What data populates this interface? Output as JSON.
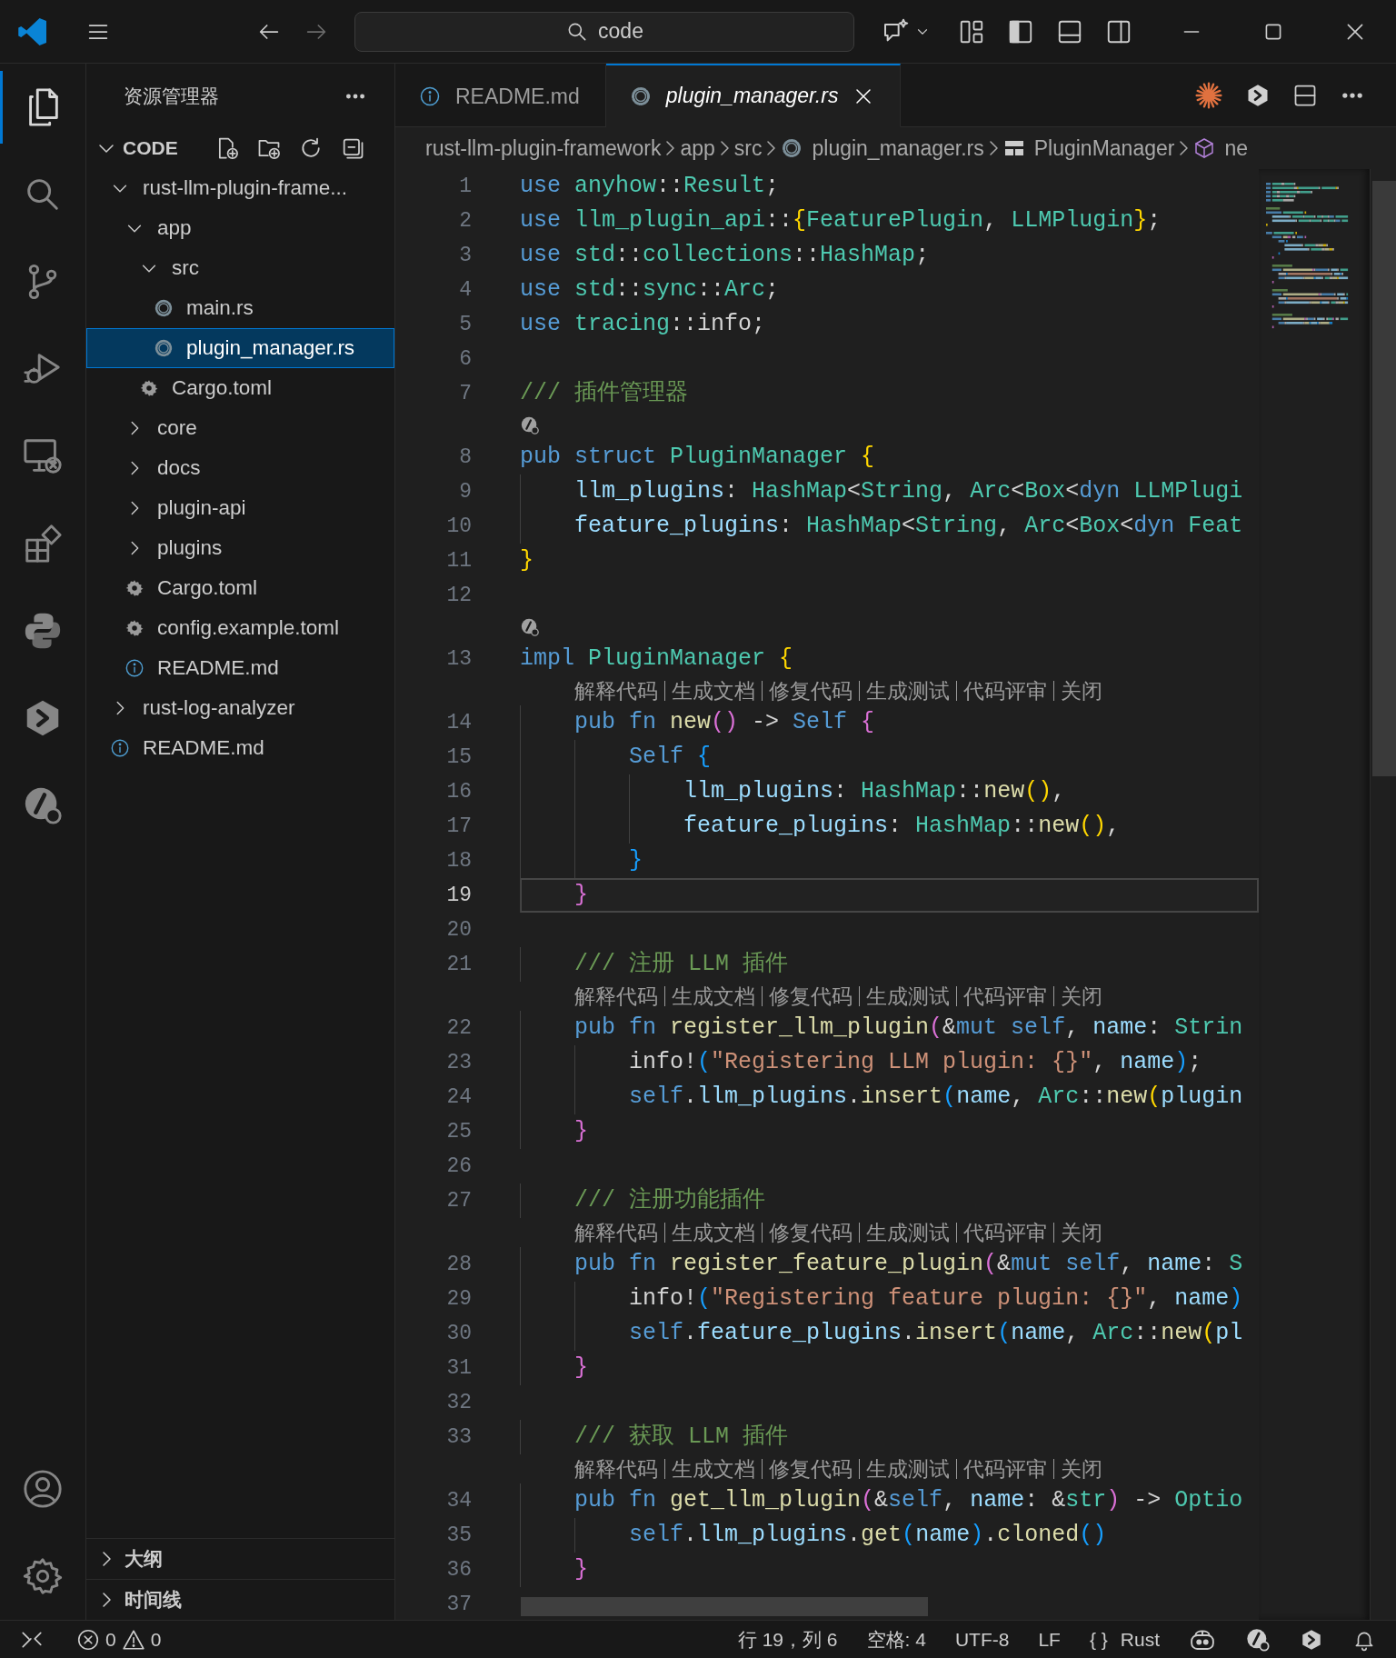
{
  "title_bar": {
    "search": {
      "text": "code"
    }
  },
  "activity_bar": {
    "top": [
      {
        "kind": "explorer",
        "selected": true
      },
      {
        "kind": "search",
        "selected": false
      },
      {
        "kind": "source-control",
        "selected": false
      },
      {
        "kind": "run-debug",
        "selected": false
      },
      {
        "kind": "remote",
        "selected": false
      },
      {
        "kind": "extensions",
        "selected": false
      },
      {
        "kind": "python",
        "selected": false
      },
      {
        "kind": "hex-logo",
        "selected": false
      },
      {
        "kind": "slash-logo",
        "selected": false
      }
    ],
    "bottom": [
      {
        "kind": "account"
      },
      {
        "kind": "settings"
      }
    ]
  },
  "sidebar": {
    "title": "资源管理器",
    "section": {
      "label": "CODE",
      "expanded": true
    },
    "tree": [
      {
        "label": "rust-llm-plugin-frame...",
        "kind": "folder",
        "expanded": true,
        "selected": false,
        "children": [
          {
            "label": "app",
            "kind": "folder",
            "expanded": true,
            "selected": false,
            "children": [
              {
                "label": "src",
                "kind": "folder",
                "expanded": true,
                "selected": false,
                "children": [
                  {
                    "label": "main.rs",
                    "kind": "rust-file",
                    "selected": false
                  },
                  {
                    "label": "plugin_manager.rs",
                    "kind": "rust-file",
                    "selected": true
                  }
                ]
              },
              {
                "label": "Cargo.toml",
                "kind": "toml-file",
                "selected": false
              }
            ]
          },
          {
            "label": "core",
            "kind": "folder",
            "expanded": false,
            "selected": false
          },
          {
            "label": "docs",
            "kind": "folder",
            "expanded": false,
            "selected": false
          },
          {
            "label": "plugin-api",
            "kind": "folder",
            "expanded": false,
            "selected": false
          },
          {
            "label": "plugins",
            "kind": "folder",
            "expanded": false,
            "selected": false
          },
          {
            "label": "Cargo.toml",
            "kind": "toml-file",
            "selected": false
          },
          {
            "label": "config.example.toml",
            "kind": "toml-file",
            "selected": false
          },
          {
            "label": "README.md",
            "kind": "info-file",
            "selected": false
          }
        ]
      },
      {
        "label": "rust-log-analyzer",
        "kind": "folder",
        "expanded": false,
        "selected": false
      },
      {
        "label": "README.md",
        "kind": "info-file",
        "selected": false
      }
    ],
    "panels": [
      {
        "label": "大纲",
        "expanded": false
      },
      {
        "label": "时间线",
        "expanded": false
      }
    ]
  },
  "tabs": [
    {
      "label": "README.md",
      "kind": "info-file",
      "selected": false,
      "preview": false
    },
    {
      "label": "plugin_manager.rs",
      "kind": "rust-file",
      "selected": true,
      "preview": true
    }
  ],
  "breadcrumb": [
    {
      "label": "rust-llm-plugin-framework",
      "kind": "folder"
    },
    {
      "label": "app",
      "kind": "folder"
    },
    {
      "label": "src",
      "kind": "folder"
    },
    {
      "label": "plugin_manager.rs",
      "kind": "rust-file"
    },
    {
      "label": "PluginManager",
      "kind": "struct"
    },
    {
      "label": "ne",
      "kind": "module"
    }
  ],
  "editor": {
    "rows": [
      {
        "kind": "code",
        "number": "1",
        "current": false,
        "tokens": [
          {
            "text": "use ",
            "kind": "kw"
          },
          {
            "text": "anyhow",
            "kind": "type"
          },
          {
            "text": "::",
            "kind": "p"
          },
          {
            "text": "Result",
            "kind": "type"
          },
          {
            "text": ";",
            "kind": "p"
          }
        ]
      },
      {
        "kind": "code",
        "number": "2",
        "current": false,
        "tokens": [
          {
            "text": "use ",
            "kind": "kw"
          },
          {
            "text": "llm_plugin_api",
            "kind": "type"
          },
          {
            "text": "::",
            "kind": "p"
          },
          {
            "text": "{",
            "kind": "b1"
          },
          {
            "text": "FeaturePlugin",
            "kind": "type"
          },
          {
            "text": ", ",
            "kind": "p"
          },
          {
            "text": "LLMPlugin",
            "kind": "type"
          },
          {
            "text": "}",
            "kind": "b1"
          },
          {
            "text": ";",
            "kind": "p"
          }
        ]
      },
      {
        "kind": "code",
        "number": "3",
        "current": false,
        "tokens": [
          {
            "text": "use ",
            "kind": "kw"
          },
          {
            "text": "std",
            "kind": "type"
          },
          {
            "text": "::",
            "kind": "p"
          },
          {
            "text": "collections",
            "kind": "type"
          },
          {
            "text": "::",
            "kind": "p"
          },
          {
            "text": "HashMap",
            "kind": "type"
          },
          {
            "text": ";",
            "kind": "p"
          }
        ]
      },
      {
        "kind": "code",
        "number": "4",
        "current": false,
        "tokens": [
          {
            "text": "use ",
            "kind": "kw"
          },
          {
            "text": "std",
            "kind": "type"
          },
          {
            "text": "::",
            "kind": "p"
          },
          {
            "text": "sync",
            "kind": "type"
          },
          {
            "text": "::",
            "kind": "p"
          },
          {
            "text": "Arc",
            "kind": "type"
          },
          {
            "text": ";",
            "kind": "p"
          }
        ]
      },
      {
        "kind": "code",
        "number": "5",
        "current": false,
        "tokens": [
          {
            "text": "use ",
            "kind": "kw"
          },
          {
            "text": "tracing",
            "kind": "type"
          },
          {
            "text": "::info;",
            "kind": "p"
          }
        ]
      },
      {
        "kind": "code",
        "number": "6",
        "current": false
      },
      {
        "kind": "code",
        "number": "7",
        "current": false,
        "tokens": [
          {
            "text": "/// 插件管理器",
            "kind": "cmt"
          }
        ]
      },
      {
        "kind": "hint-icon"
      },
      {
        "kind": "code",
        "number": "8",
        "current": false,
        "tokens": [
          {
            "text": "pub struct ",
            "kind": "kw"
          },
          {
            "text": "PluginManager ",
            "kind": "type"
          },
          {
            "text": "{",
            "kind": "b1"
          }
        ]
      },
      {
        "kind": "code",
        "number": "9",
        "current": false,
        "tokens": [
          {
            "text": "    llm_plugins",
            "kind": "var"
          },
          {
            "text": ": ",
            "kind": "p"
          },
          {
            "text": "HashMap",
            "kind": "type"
          },
          {
            "text": "<",
            "kind": "p"
          },
          {
            "text": "String",
            "kind": "type"
          },
          {
            "text": ", ",
            "kind": "p"
          },
          {
            "text": "Arc",
            "kind": "type"
          },
          {
            "text": "<",
            "kind": "p"
          },
          {
            "text": "Box",
            "kind": "type"
          },
          {
            "text": "<",
            "kind": "p"
          },
          {
            "text": "dyn ",
            "kind": "kw"
          },
          {
            "text": "LLMPlugi",
            "kind": "type"
          }
        ]
      },
      {
        "kind": "code",
        "number": "10",
        "current": false,
        "tokens": [
          {
            "text": "    feature_plugins",
            "kind": "var"
          },
          {
            "text": ": ",
            "kind": "p"
          },
          {
            "text": "HashMap",
            "kind": "type"
          },
          {
            "text": "<",
            "kind": "p"
          },
          {
            "text": "String",
            "kind": "type"
          },
          {
            "text": ", ",
            "kind": "p"
          },
          {
            "text": "Arc",
            "kind": "type"
          },
          {
            "text": "<",
            "kind": "p"
          },
          {
            "text": "Box",
            "kind": "type"
          },
          {
            "text": "<",
            "kind": "p"
          },
          {
            "text": "dyn ",
            "kind": "kw"
          },
          {
            "text": "Feat",
            "kind": "type"
          }
        ]
      },
      {
        "kind": "code",
        "number": "11",
        "current": false,
        "tokens": [
          {
            "text": "}",
            "kind": "b1"
          }
        ]
      },
      {
        "kind": "code",
        "number": "12",
        "current": false
      },
      {
        "kind": "hint-icon"
      },
      {
        "kind": "code",
        "number": "13",
        "current": false,
        "tokens": [
          {
            "text": "impl ",
            "kind": "kw"
          },
          {
            "text": "PluginManager ",
            "kind": "type"
          },
          {
            "text": "{",
            "kind": "b1"
          }
        ]
      },
      {
        "kind": "lens",
        "actions": [
          "解释代码",
          "生成文档",
          "修复代码",
          "生成测试",
          "代码评审",
          "关闭"
        ]
      },
      {
        "kind": "code",
        "number": "14",
        "current": false,
        "tokens": [
          {
            "text": "    pub fn ",
            "kind": "kw"
          },
          {
            "text": "new",
            "kind": "fn"
          },
          {
            "text": "()",
            "kind": "b2"
          },
          {
            "text": " -> ",
            "kind": "p"
          },
          {
            "text": "Self ",
            "kind": "kw"
          },
          {
            "text": "{",
            "kind": "b2"
          }
        ]
      },
      {
        "kind": "code",
        "number": "15",
        "current": false,
        "tokens": [
          {
            "text": "        Self ",
            "kind": "kw"
          },
          {
            "text": "{",
            "kind": "b3"
          }
        ]
      },
      {
        "kind": "code",
        "number": "16",
        "current": false,
        "tokens": [
          {
            "text": "            llm_plugins",
            "kind": "var"
          },
          {
            "text": ": ",
            "kind": "p"
          },
          {
            "text": "HashMap",
            "kind": "type"
          },
          {
            "text": "::",
            "kind": "p"
          },
          {
            "text": "new",
            "kind": "fn"
          },
          {
            "text": "()",
            "kind": "b1"
          },
          {
            "text": ",",
            "kind": "p"
          }
        ]
      },
      {
        "kind": "code",
        "number": "17",
        "current": false,
        "tokens": [
          {
            "text": "            feature_plugins",
            "kind": "var"
          },
          {
            "text": ": ",
            "kind": "p"
          },
          {
            "text": "HashMap",
            "kind": "type"
          },
          {
            "text": "::",
            "kind": "p"
          },
          {
            "text": "new",
            "kind": "fn"
          },
          {
            "text": "()",
            "kind": "b1"
          },
          {
            "text": ",",
            "kind": "p"
          }
        ]
      },
      {
        "kind": "code",
        "number": "18",
        "current": false,
        "tokens": [
          {
            "text": "        }",
            "kind": "b3"
          }
        ]
      },
      {
        "kind": "code",
        "number": "19",
        "current": true,
        "tokens": [
          {
            "text": "    }",
            "kind": "b2"
          }
        ]
      },
      {
        "kind": "code",
        "number": "20",
        "current": false
      },
      {
        "kind": "code",
        "number": "21",
        "current": false,
        "tokens": [
          {
            "text": "    /// 注册 LLM 插件",
            "kind": "cmt"
          }
        ]
      },
      {
        "kind": "lens",
        "actions": [
          "解释代码",
          "生成文档",
          "修复代码",
          "生成测试",
          "代码评审",
          "关闭"
        ]
      },
      {
        "kind": "code",
        "number": "22",
        "current": false,
        "tokens": [
          {
            "text": "    pub fn ",
            "kind": "kw"
          },
          {
            "text": "register_llm_plugin",
            "kind": "fn"
          },
          {
            "text": "(",
            "kind": "b2"
          },
          {
            "text": "&",
            "kind": "p"
          },
          {
            "text": "mut self",
            "kind": "kw"
          },
          {
            "text": ", ",
            "kind": "p"
          },
          {
            "text": "name",
            "kind": "var"
          },
          {
            "text": ": ",
            "kind": "p"
          },
          {
            "text": "Strin",
            "kind": "type"
          }
        ]
      },
      {
        "kind": "code",
        "number": "23",
        "current": false,
        "tokens": [
          {
            "text": "        info!",
            "kind": "p"
          },
          {
            "text": "(",
            "kind": "b3"
          },
          {
            "text": "\"Registering LLM plugin: {}\"",
            "kind": "str"
          },
          {
            "text": ", ",
            "kind": "p"
          },
          {
            "text": "name",
            "kind": "var"
          },
          {
            "text": ")",
            "kind": "b3"
          },
          {
            "text": ";",
            "kind": "p"
          }
        ]
      },
      {
        "kind": "code",
        "number": "24",
        "current": false,
        "tokens": [
          {
            "text": "        self",
            "kind": "kw"
          },
          {
            "text": ".",
            "kind": "p"
          },
          {
            "text": "llm_plugins",
            "kind": "var"
          },
          {
            "text": ".",
            "kind": "p"
          },
          {
            "text": "insert",
            "kind": "fn"
          },
          {
            "text": "(",
            "kind": "b3"
          },
          {
            "text": "name",
            "kind": "var"
          },
          {
            "text": ", ",
            "kind": "p"
          },
          {
            "text": "Arc",
            "kind": "type"
          },
          {
            "text": "::",
            "kind": "p"
          },
          {
            "text": "new",
            "kind": "fn"
          },
          {
            "text": "(",
            "kind": "b1"
          },
          {
            "text": "plugin",
            "kind": "var"
          }
        ]
      },
      {
        "kind": "code",
        "number": "25",
        "current": false,
        "tokens": [
          {
            "text": "    }",
            "kind": "b2"
          }
        ]
      },
      {
        "kind": "code",
        "number": "26",
        "current": false
      },
      {
        "kind": "code",
        "number": "27",
        "current": false,
        "tokens": [
          {
            "text": "    /// 注册功能插件",
            "kind": "cmt"
          }
        ]
      },
      {
        "kind": "lens",
        "actions": [
          "解释代码",
          "生成文档",
          "修复代码",
          "生成测试",
          "代码评审",
          "关闭"
        ]
      },
      {
        "kind": "code",
        "number": "28",
        "current": false,
        "tokens": [
          {
            "text": "    pub fn ",
            "kind": "kw"
          },
          {
            "text": "register_feature_plugin",
            "kind": "fn"
          },
          {
            "text": "(",
            "kind": "b2"
          },
          {
            "text": "&",
            "kind": "p"
          },
          {
            "text": "mut self",
            "kind": "kw"
          },
          {
            "text": ", ",
            "kind": "p"
          },
          {
            "text": "name",
            "kind": "var"
          },
          {
            "text": ": ",
            "kind": "p"
          },
          {
            "text": "S",
            "kind": "type"
          }
        ]
      },
      {
        "kind": "code",
        "number": "29",
        "current": false,
        "tokens": [
          {
            "text": "        info!",
            "kind": "p"
          },
          {
            "text": "(",
            "kind": "b3"
          },
          {
            "text": "\"Registering feature plugin: {}\"",
            "kind": "str"
          },
          {
            "text": ", ",
            "kind": "p"
          },
          {
            "text": "name",
            "kind": "var"
          },
          {
            "text": ")",
            "kind": "b3"
          }
        ]
      },
      {
        "kind": "code",
        "number": "30",
        "current": false,
        "tokens": [
          {
            "text": "        self",
            "kind": "kw"
          },
          {
            "text": ".",
            "kind": "p"
          },
          {
            "text": "feature_plugins",
            "kind": "var"
          },
          {
            "text": ".",
            "kind": "p"
          },
          {
            "text": "insert",
            "kind": "fn"
          },
          {
            "text": "(",
            "kind": "b3"
          },
          {
            "text": "name",
            "kind": "var"
          },
          {
            "text": ", ",
            "kind": "p"
          },
          {
            "text": "Arc",
            "kind": "type"
          },
          {
            "text": "::",
            "kind": "p"
          },
          {
            "text": "new",
            "kind": "fn"
          },
          {
            "text": "(",
            "kind": "b1"
          },
          {
            "text": "pl",
            "kind": "var"
          }
        ]
      },
      {
        "kind": "code",
        "number": "31",
        "current": false,
        "tokens": [
          {
            "text": "    }",
            "kind": "b2"
          }
        ]
      },
      {
        "kind": "code",
        "number": "32",
        "current": false
      },
      {
        "kind": "code",
        "number": "33",
        "current": false,
        "tokens": [
          {
            "text": "    /// 获取 LLM 插件",
            "kind": "cmt"
          }
        ]
      },
      {
        "kind": "lens",
        "actions": [
          "解释代码",
          "生成文档",
          "修复代码",
          "生成测试",
          "代码评审",
          "关闭"
        ]
      },
      {
        "kind": "code",
        "number": "34",
        "current": false,
        "tokens": [
          {
            "text": "    pub fn ",
            "kind": "kw"
          },
          {
            "text": "get_llm_plugin",
            "kind": "fn"
          },
          {
            "text": "(",
            "kind": "b2"
          },
          {
            "text": "&",
            "kind": "p"
          },
          {
            "text": "self",
            "kind": "kw"
          },
          {
            "text": ", ",
            "kind": "p"
          },
          {
            "text": "name",
            "kind": "var"
          },
          {
            "text": ": ",
            "kind": "p"
          },
          {
            "text": "&",
            "kind": "p"
          },
          {
            "text": "str",
            "kind": "type"
          },
          {
            "text": ")",
            "kind": "b2"
          },
          {
            "text": " -> ",
            "kind": "p"
          },
          {
            "text": "Optio",
            "kind": "type"
          }
        ]
      },
      {
        "kind": "code",
        "number": "35",
        "current": false,
        "tokens": [
          {
            "text": "        self",
            "kind": "kw"
          },
          {
            "text": ".",
            "kind": "p"
          },
          {
            "text": "llm_plugins",
            "kind": "var"
          },
          {
            "text": ".",
            "kind": "p"
          },
          {
            "text": "get",
            "kind": "fn"
          },
          {
            "text": "(",
            "kind": "b3"
          },
          {
            "text": "name",
            "kind": "var"
          },
          {
            "text": ")",
            "kind": "b3"
          },
          {
            "text": ".",
            "kind": "p"
          },
          {
            "text": "cloned",
            "kind": "fn"
          },
          {
            "text": "()",
            "kind": "b3"
          }
        ]
      },
      {
        "kind": "code",
        "number": "36",
        "current": false,
        "tokens": [
          {
            "text": "    }",
            "kind": "b2"
          }
        ]
      },
      {
        "kind": "code",
        "number": "37",
        "current": false
      }
    ]
  },
  "status_bar": {
    "errors": "0",
    "warnings": "0",
    "position": "行 19，列 6",
    "indent": "空格: 4",
    "encoding": "UTF-8",
    "eol": "LF",
    "language_icon": "{ }",
    "language": "Rust"
  }
}
